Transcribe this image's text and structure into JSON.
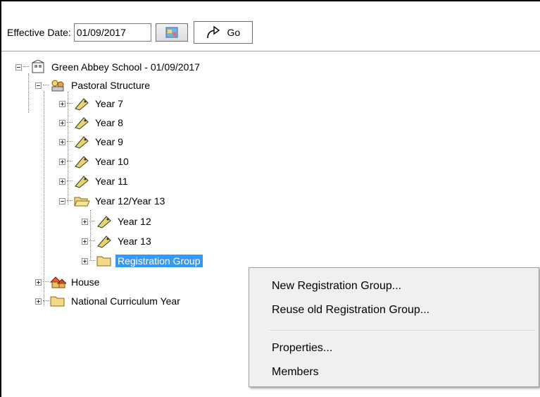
{
  "toolbar": {
    "effective_date_label": "Effective Date:",
    "effective_date_value": "01/09/2017",
    "go_label": "Go"
  },
  "tree": {
    "root": "Green Abbey School - 01/09/2017",
    "pastoral": "Pastoral Structure",
    "year7": "Year  7",
    "year8": "Year  8",
    "year9": "Year  9",
    "year10": "Year 10",
    "year11": "Year 11",
    "year12_13": "Year 12/Year 13",
    "year12": "Year 12",
    "year13": "Year 13",
    "registration_group": "Registration Group",
    "house": "House",
    "national_curriculum": "National Curriculum Year"
  },
  "context_menu": {
    "new_reg_group": "New Registration Group...",
    "reuse_reg_group": "Reuse old Registration Group...",
    "properties": "Properties...",
    "members": "Members"
  },
  "colors": {
    "selection": "#3399ff",
    "menu_bg": "#f0f0f0"
  }
}
